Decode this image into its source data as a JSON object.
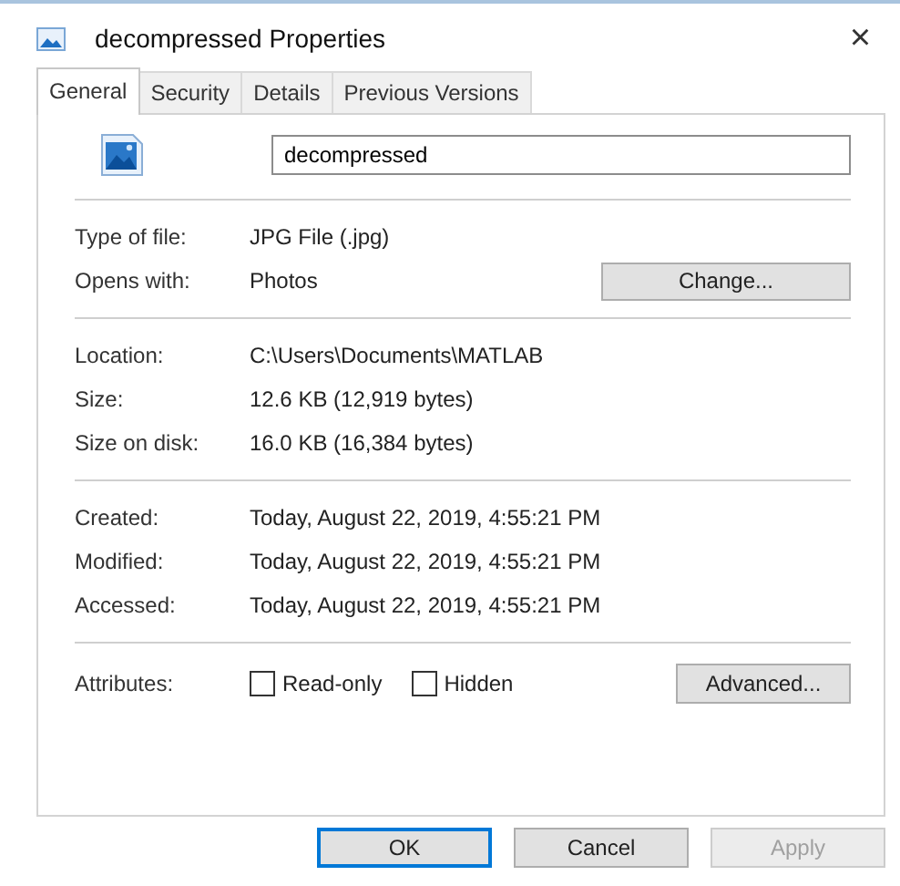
{
  "window": {
    "title": "decompressed Properties",
    "close": "×"
  },
  "tabs": [
    {
      "label": "General",
      "selected": true
    },
    {
      "label": "Security",
      "selected": false
    },
    {
      "label": "Details",
      "selected": false
    },
    {
      "label": "Previous Versions",
      "selected": false
    }
  ],
  "file_name": "decompressed",
  "sections": [
    {
      "rows": [
        {
          "label": "Type of file:",
          "value": "JPG File (.jpg)"
        },
        {
          "label": "Opens with:",
          "value": "Photos",
          "button": "Change..."
        }
      ]
    },
    {
      "rows": [
        {
          "label": "Location:",
          "value": "C:\\Users\\Documents\\MATLAB"
        },
        {
          "label": "Size:",
          "value": "12.6 KB (12,919 bytes)"
        },
        {
          "label": "Size on disk:",
          "value": "16.0 KB (16,384 bytes)"
        }
      ]
    },
    {
      "rows": [
        {
          "label": "Created:",
          "value": "Today, August 22, 2019, 4:55:21 PM"
        },
        {
          "label": "Modified:",
          "value": "Today, August 22, 2019, 4:55:21 PM"
        },
        {
          "label": "Accessed:",
          "value": "Today, August 22, 2019, 4:55:21 PM"
        }
      ]
    }
  ],
  "attributes": {
    "label": "Attributes:",
    "checkboxes": [
      {
        "label": "Read-only",
        "checked": false
      },
      {
        "label": "Hidden",
        "checked": false
      }
    ],
    "button": "Advanced..."
  },
  "buttons": [
    {
      "label": "OK",
      "default": true,
      "disabled": false
    },
    {
      "label": "Cancel",
      "default": false,
      "disabled": false
    },
    {
      "label": "Apply",
      "default": false,
      "disabled": true
    }
  ]
}
